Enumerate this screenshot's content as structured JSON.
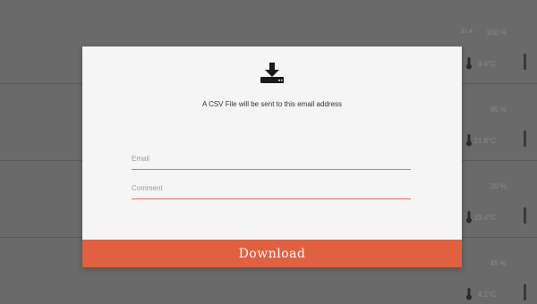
{
  "background": {
    "rows": [
      {
        "small": "31.4",
        "pct": "100 %",
        "temp": "9.4°C"
      },
      {
        "small": "",
        "pct": "95 %",
        "temp": "21.8°C"
      },
      {
        "small": "",
        "pct": "30 %",
        "temp": "19.4°C"
      },
      {
        "small": "",
        "pct": "45 %",
        "temp": "4.1°C"
      }
    ]
  },
  "modal": {
    "icon": "download-icon",
    "message": "A CSV File will be sent to this email address",
    "email_placeholder": "Email",
    "comment_placeholder": "Comment",
    "download_label": "Download"
  },
  "colors": {
    "accent": "#e06040",
    "field_underline": "#e07060",
    "overlay": "#6a6a6a",
    "modal_bg": "#f5f5f5"
  }
}
